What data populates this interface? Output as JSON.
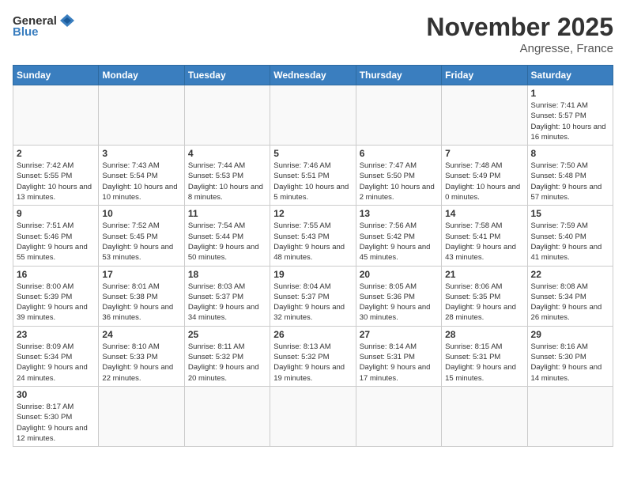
{
  "header": {
    "logo_general": "General",
    "logo_blue": "Blue",
    "month_title": "November 2025",
    "location": "Angresse, France"
  },
  "days_of_week": [
    "Sunday",
    "Monday",
    "Tuesday",
    "Wednesday",
    "Thursday",
    "Friday",
    "Saturday"
  ],
  "weeks": [
    [
      {
        "day": "",
        "info": ""
      },
      {
        "day": "",
        "info": ""
      },
      {
        "day": "",
        "info": ""
      },
      {
        "day": "",
        "info": ""
      },
      {
        "day": "",
        "info": ""
      },
      {
        "day": "",
        "info": ""
      },
      {
        "day": "1",
        "info": "Sunrise: 7:41 AM\nSunset: 5:57 PM\nDaylight: 10 hours\nand 16 minutes."
      }
    ],
    [
      {
        "day": "2",
        "info": "Sunrise: 7:42 AM\nSunset: 5:55 PM\nDaylight: 10 hours\nand 13 minutes."
      },
      {
        "day": "3",
        "info": "Sunrise: 7:43 AM\nSunset: 5:54 PM\nDaylight: 10 hours\nand 10 minutes."
      },
      {
        "day": "4",
        "info": "Sunrise: 7:44 AM\nSunset: 5:53 PM\nDaylight: 10 hours\nand 8 minutes."
      },
      {
        "day": "5",
        "info": "Sunrise: 7:46 AM\nSunset: 5:51 PM\nDaylight: 10 hours\nand 5 minutes."
      },
      {
        "day": "6",
        "info": "Sunrise: 7:47 AM\nSunset: 5:50 PM\nDaylight: 10 hours\nand 2 minutes."
      },
      {
        "day": "7",
        "info": "Sunrise: 7:48 AM\nSunset: 5:49 PM\nDaylight: 10 hours\nand 0 minutes."
      },
      {
        "day": "8",
        "info": "Sunrise: 7:50 AM\nSunset: 5:48 PM\nDaylight: 9 hours\nand 57 minutes."
      }
    ],
    [
      {
        "day": "9",
        "info": "Sunrise: 7:51 AM\nSunset: 5:46 PM\nDaylight: 9 hours\nand 55 minutes."
      },
      {
        "day": "10",
        "info": "Sunrise: 7:52 AM\nSunset: 5:45 PM\nDaylight: 9 hours\nand 53 minutes."
      },
      {
        "day": "11",
        "info": "Sunrise: 7:54 AM\nSunset: 5:44 PM\nDaylight: 9 hours\nand 50 minutes."
      },
      {
        "day": "12",
        "info": "Sunrise: 7:55 AM\nSunset: 5:43 PM\nDaylight: 9 hours\nand 48 minutes."
      },
      {
        "day": "13",
        "info": "Sunrise: 7:56 AM\nSunset: 5:42 PM\nDaylight: 9 hours\nand 45 minutes."
      },
      {
        "day": "14",
        "info": "Sunrise: 7:58 AM\nSunset: 5:41 PM\nDaylight: 9 hours\nand 43 minutes."
      },
      {
        "day": "15",
        "info": "Sunrise: 7:59 AM\nSunset: 5:40 PM\nDaylight: 9 hours\nand 41 minutes."
      }
    ],
    [
      {
        "day": "16",
        "info": "Sunrise: 8:00 AM\nSunset: 5:39 PM\nDaylight: 9 hours\nand 39 minutes."
      },
      {
        "day": "17",
        "info": "Sunrise: 8:01 AM\nSunset: 5:38 PM\nDaylight: 9 hours\nand 36 minutes."
      },
      {
        "day": "18",
        "info": "Sunrise: 8:03 AM\nSunset: 5:37 PM\nDaylight: 9 hours\nand 34 minutes."
      },
      {
        "day": "19",
        "info": "Sunrise: 8:04 AM\nSunset: 5:37 PM\nDaylight: 9 hours\nand 32 minutes."
      },
      {
        "day": "20",
        "info": "Sunrise: 8:05 AM\nSunset: 5:36 PM\nDaylight: 9 hours\nand 30 minutes."
      },
      {
        "day": "21",
        "info": "Sunrise: 8:06 AM\nSunset: 5:35 PM\nDaylight: 9 hours\nand 28 minutes."
      },
      {
        "day": "22",
        "info": "Sunrise: 8:08 AM\nSunset: 5:34 PM\nDaylight: 9 hours\nand 26 minutes."
      }
    ],
    [
      {
        "day": "23",
        "info": "Sunrise: 8:09 AM\nSunset: 5:34 PM\nDaylight: 9 hours\nand 24 minutes."
      },
      {
        "day": "24",
        "info": "Sunrise: 8:10 AM\nSunset: 5:33 PM\nDaylight: 9 hours\nand 22 minutes."
      },
      {
        "day": "25",
        "info": "Sunrise: 8:11 AM\nSunset: 5:32 PM\nDaylight: 9 hours\nand 20 minutes."
      },
      {
        "day": "26",
        "info": "Sunrise: 8:13 AM\nSunset: 5:32 PM\nDaylight: 9 hours\nand 19 minutes."
      },
      {
        "day": "27",
        "info": "Sunrise: 8:14 AM\nSunset: 5:31 PM\nDaylight: 9 hours\nand 17 minutes."
      },
      {
        "day": "28",
        "info": "Sunrise: 8:15 AM\nSunset: 5:31 PM\nDaylight: 9 hours\nand 15 minutes."
      },
      {
        "day": "29",
        "info": "Sunrise: 8:16 AM\nSunset: 5:30 PM\nDaylight: 9 hours\nand 14 minutes."
      }
    ],
    [
      {
        "day": "30",
        "info": "Sunrise: 8:17 AM\nSunset: 5:30 PM\nDaylight: 9 hours\nand 12 minutes."
      },
      {
        "day": "",
        "info": ""
      },
      {
        "day": "",
        "info": ""
      },
      {
        "day": "",
        "info": ""
      },
      {
        "day": "",
        "info": ""
      },
      {
        "day": "",
        "info": ""
      },
      {
        "day": "",
        "info": ""
      }
    ]
  ]
}
